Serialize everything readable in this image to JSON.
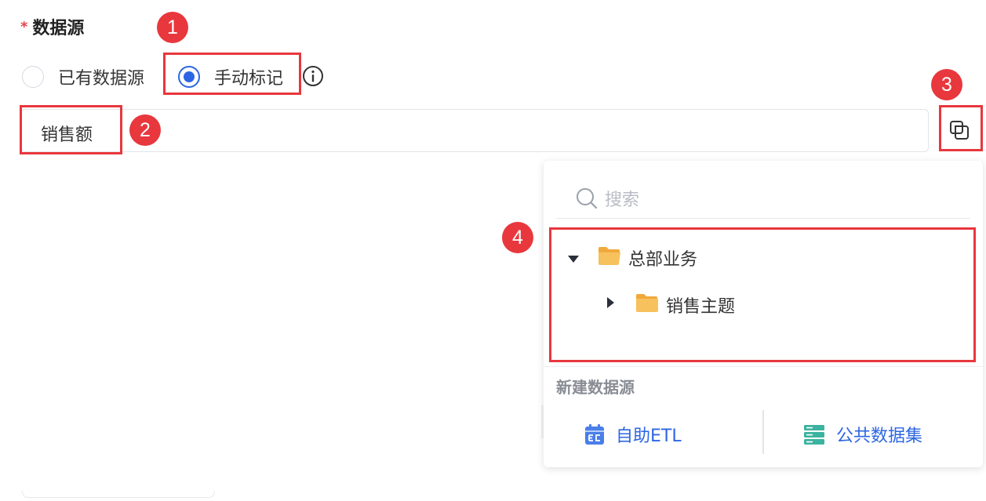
{
  "section": {
    "required_mark": "*",
    "title": "数据源"
  },
  "radio": {
    "options": [
      {
        "label": "已有数据源",
        "checked": false
      },
      {
        "label": "手动标记",
        "checked": true
      }
    ]
  },
  "field": {
    "value": "销售额"
  },
  "dropdown": {
    "search_placeholder": "搜索",
    "tree": [
      {
        "label": "总部业务",
        "expanded": true,
        "level": 0
      },
      {
        "label": "销售主题",
        "expanded": false,
        "level": 1
      }
    ],
    "new_section_title": "新建数据源",
    "actions": [
      {
        "label": "自助ETL",
        "icon": "etl-icon"
      },
      {
        "label": "公共数据集",
        "icon": "dataset-icon"
      }
    ]
  },
  "annotations": {
    "markers": [
      "1",
      "2",
      "3",
      "4"
    ]
  },
  "colors": {
    "primary": "#2d66e3",
    "annotation_red": "#e8373d",
    "folder": "#f7b84a",
    "dataset_icon": "#3bb3a0"
  }
}
